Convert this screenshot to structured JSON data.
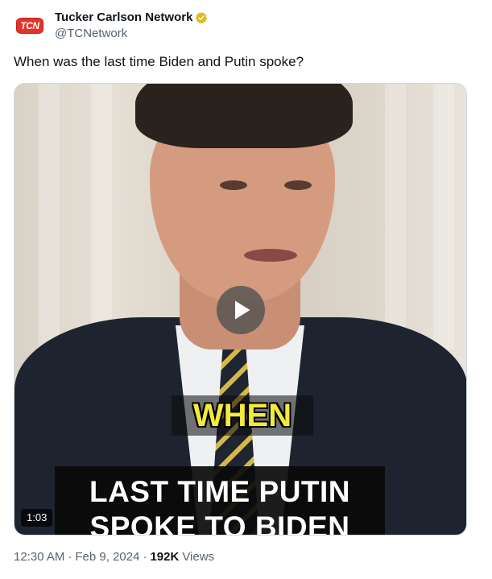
{
  "account": {
    "avatar_text": "TCN",
    "display_name": "Tucker Carlson Network",
    "handle": "@TCNetwork",
    "verified_color": "#e2b719"
  },
  "tweet": {
    "text": "When was the last time Biden and Putin spoke?"
  },
  "video": {
    "caption_top": "WHEN",
    "caption_line1": "LAST TIME PUTIN",
    "caption_line2": "SPOKE TO BIDEN",
    "duration": "1:03",
    "play_icon": "play-icon"
  },
  "meta": {
    "time": "12:30 AM",
    "date": "Feb 9, 2024",
    "separator": "·",
    "views_count": "192K",
    "views_label": "Views"
  },
  "colors": {
    "text_primary": "#0f1419",
    "text_secondary": "#536471",
    "avatar_red": "#e5332a",
    "caption_yellow": "#f2ea3c"
  }
}
